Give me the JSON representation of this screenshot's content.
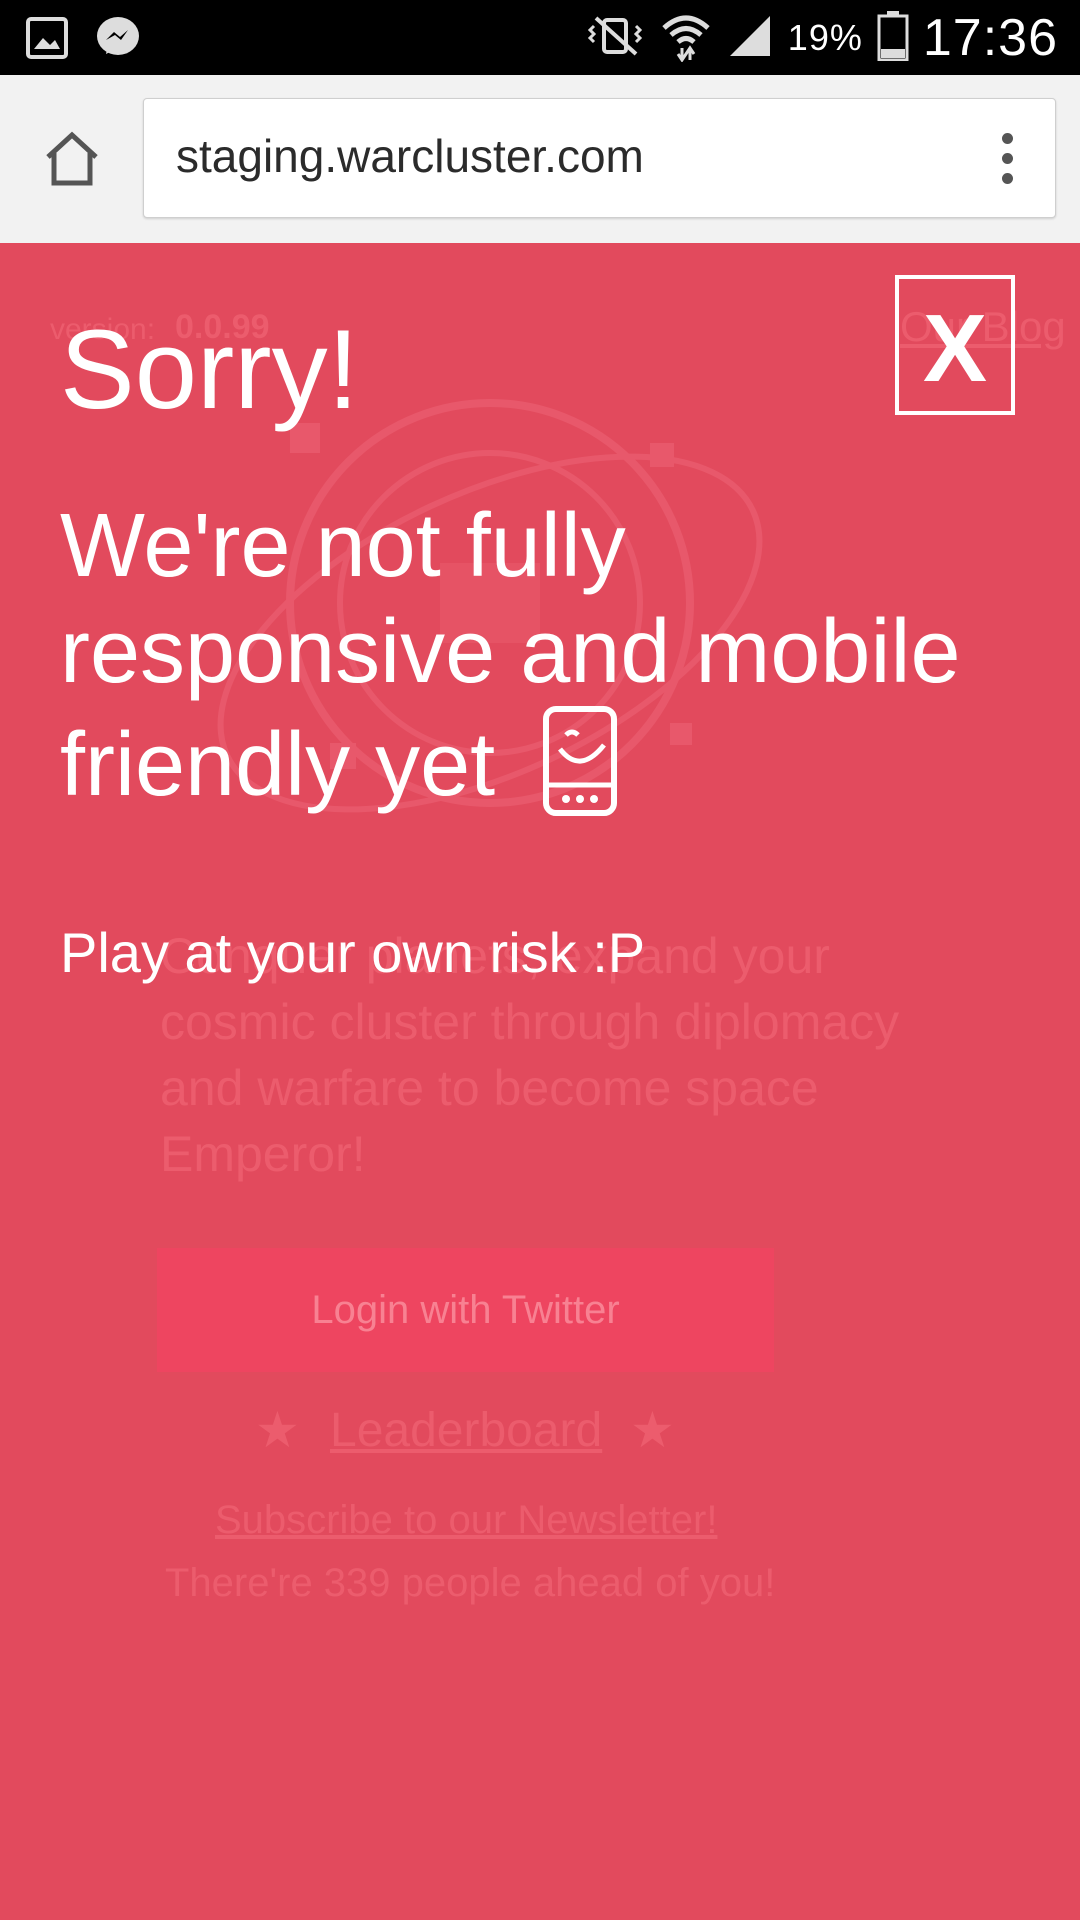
{
  "status_bar": {
    "battery_percent": "19%",
    "time": "17:36",
    "icons": [
      "gallery-icon",
      "messenger-icon",
      "mute-vibrate-icon",
      "wifi-icon",
      "signal-icon",
      "battery-icon"
    ]
  },
  "browser": {
    "url": "staging.warcluster.com",
    "icons": [
      "home-icon",
      "overflow-menu-icon"
    ]
  },
  "page": {
    "version_label": "version:",
    "version": "0.0.99",
    "blog_link": "Our Blog",
    "tagline": "Conquer planets, expand your cosmic cluster through diplomacy and warfare to become space Emperor!",
    "login_button": "Login with Twitter",
    "star": "★",
    "leaderboard": "Leaderboard",
    "newsletter": "Subscribe to our Newsletter!",
    "ahead": "There're 339 people ahead of you!"
  },
  "overlay": {
    "close_label": "X",
    "title": "Sorry!",
    "message": "We're not fully responsive and mobile friendly yet",
    "risk": "Play at your own risk :P",
    "icons": [
      "smiling-phone-icon"
    ]
  },
  "colors": {
    "background": "#e24a5d",
    "login_button": "#ee4560",
    "text": "#ffffff"
  }
}
